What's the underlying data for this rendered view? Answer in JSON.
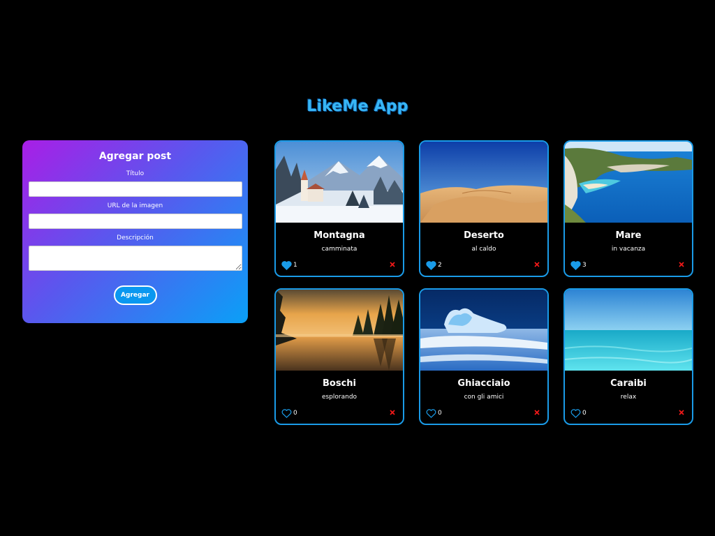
{
  "app": {
    "title": "LikeMe App"
  },
  "form": {
    "heading": "Agregar post",
    "title_label": "Título",
    "url_label": "URL de la imagen",
    "description_label": "Descripción",
    "submit_label": "Agregar"
  },
  "colors": {
    "accent": "#1a9be8",
    "delete": "#ff1a1a",
    "gradient_start": "#a91ee6",
    "gradient_end": "#0aa0f7"
  },
  "posts": [
    {
      "title": "Montagna",
      "description": "camminata",
      "likes": 1,
      "liked": true,
      "image": "snowy-mountain-village"
    },
    {
      "title": "Deserto",
      "description": "al caldo",
      "likes": 2,
      "liked": true,
      "image": "sand-dunes"
    },
    {
      "title": "Mare",
      "description": "in vacanza",
      "likes": 3,
      "liked": true,
      "image": "coastal-bay"
    },
    {
      "title": "Boschi",
      "description": "esplorando",
      "likes": 0,
      "liked": false,
      "image": "forest-lake-sunrise"
    },
    {
      "title": "Ghiacciaio",
      "description": "con gli amici",
      "likes": 0,
      "liked": false,
      "image": "ice-floe"
    },
    {
      "title": "Caraibi",
      "description": "relax",
      "likes": 0,
      "liked": false,
      "image": "turquoise-sea"
    }
  ]
}
